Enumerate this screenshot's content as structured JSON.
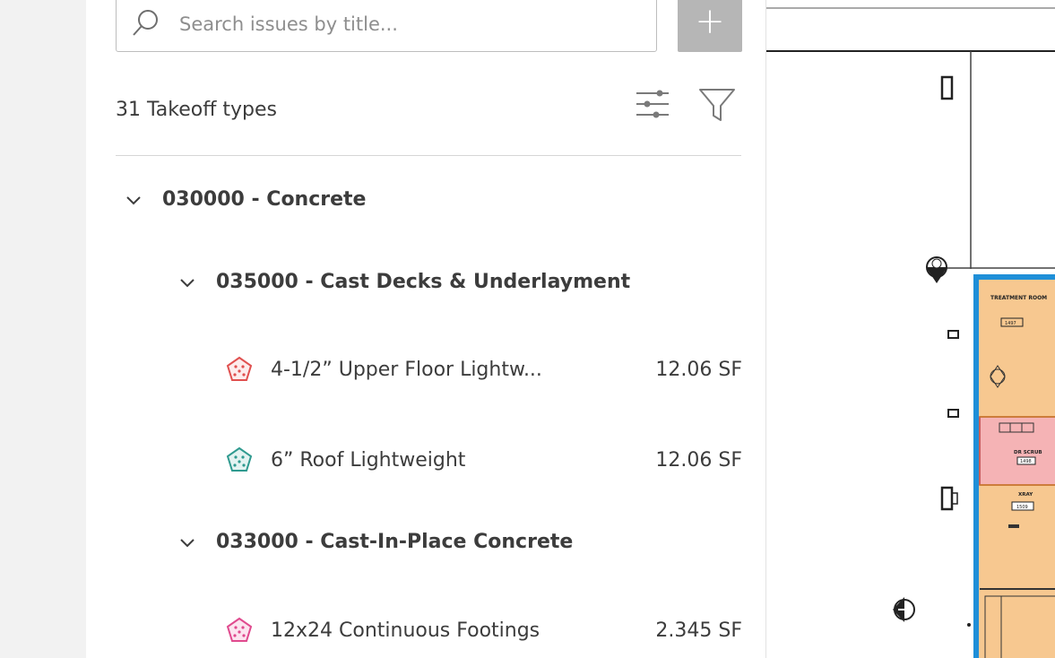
{
  "search": {
    "placeholder": "Search issues by title..."
  },
  "toolbar": {
    "add_label": "+"
  },
  "header": {
    "count_text": "31 Takeoff types"
  },
  "tree": {
    "groups": [
      {
        "label": "030000 - Concrete"
      },
      {
        "label": "035000 - Cast Decks & Underlayment"
      },
      {
        "label": "033000 - Cast-In-Place Concrete"
      }
    ],
    "items": [
      {
        "label": "4-1/2” Upper Floor Lightw...",
        "value": "12.06 SF",
        "color": "#e0504f"
      },
      {
        "label": "6” Roof Lightweight",
        "value": "12.06 SF",
        "color": "#2f9a8f"
      },
      {
        "label": "12x24 Continuous Footings",
        "value": "2.345 SF",
        "color": "#e04a8e"
      }
    ]
  },
  "drawing": {
    "rooms": [
      {
        "name": "TREATMENT ROOM",
        "number": "1497"
      },
      {
        "name": "DR SCRUB",
        "number": "1498"
      },
      {
        "name": "XRAY",
        "number": "1509"
      }
    ]
  },
  "colors": {
    "accent_blue": "#1f8fd8",
    "room_fill": "#f7c890",
    "room_pink": "#f5b3b5"
  }
}
